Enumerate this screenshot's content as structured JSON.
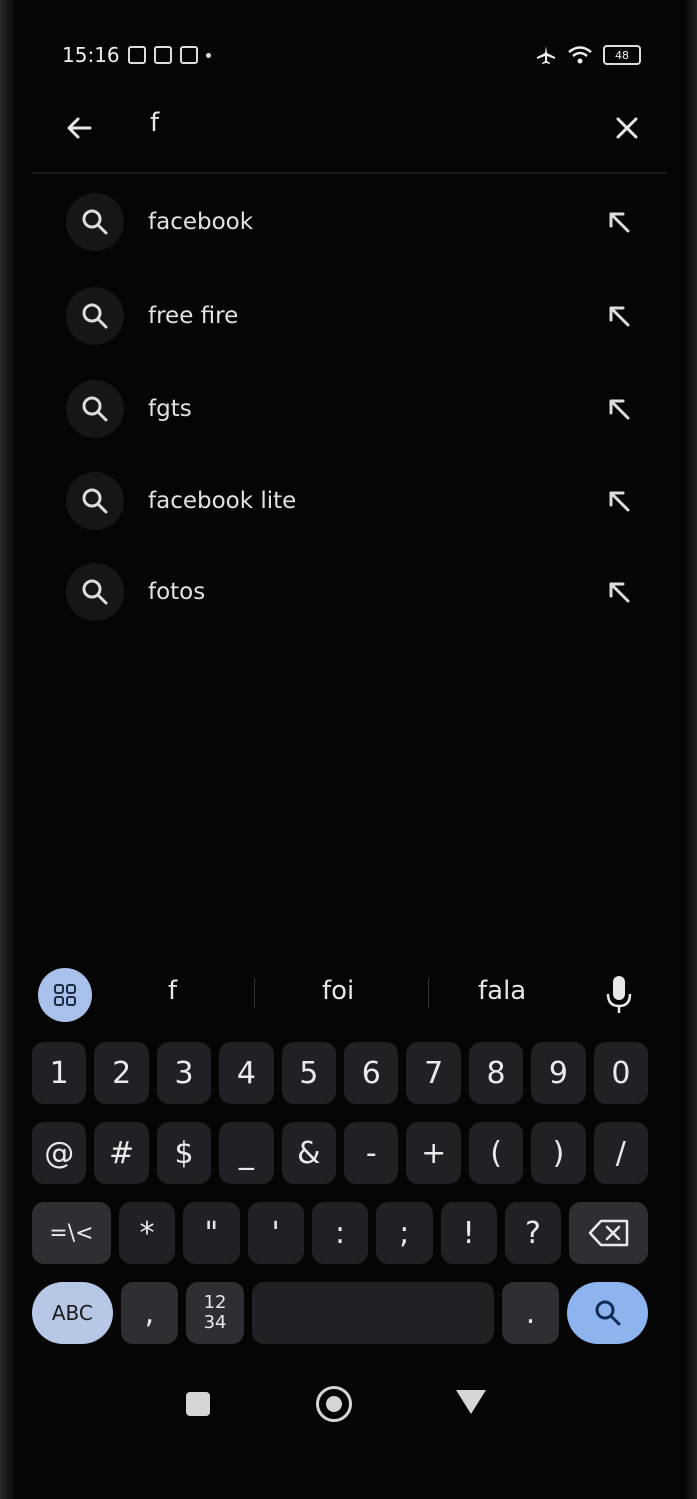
{
  "status_bar": {
    "time": "15:16",
    "battery": "48"
  },
  "search": {
    "query": "f"
  },
  "suggestions": [
    {
      "label": "facebook"
    },
    {
      "label": "free fire"
    },
    {
      "label": "fgts"
    },
    {
      "label": "facebook lite"
    },
    {
      "label": "fotos"
    }
  ],
  "keyboard": {
    "strip_words": [
      "f",
      "foi",
      "fala"
    ],
    "row1": [
      "1",
      "2",
      "3",
      "4",
      "5",
      "6",
      "7",
      "8",
      "9",
      "0"
    ],
    "row2": [
      "@",
      "#",
      "$",
      "_",
      "&",
      "-",
      "+",
      "(",
      ")",
      "/"
    ],
    "row3": [
      "=\\<",
      "*",
      "\"",
      "'",
      ":",
      ";",
      "!",
      "?"
    ],
    "row4": {
      "abc": "ABC",
      "comma": ",",
      "numpad_top": "12",
      "numpad_bottom": "34",
      "period": "."
    }
  },
  "colors": {
    "background": "#000000",
    "key": "#202124",
    "search_key": "#8db4ef",
    "abc_key": "#b7c8e6"
  },
  "icons": [
    "back-arrow-icon",
    "close-icon",
    "search-icon",
    "fill-arrow-icon",
    "grid-icon",
    "mic-icon",
    "backspace-icon",
    "recent-apps-icon",
    "home-icon",
    "back-triangle-icon"
  ]
}
